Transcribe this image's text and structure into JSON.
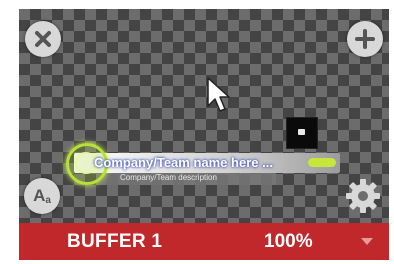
{
  "buffer": {
    "title": "BUFFER 1",
    "zoom": "100%"
  },
  "lower_third": {
    "name": "Company/Team name here ...",
    "description": "Company/Team description"
  },
  "icons": {
    "close": "close-icon",
    "add": "plus-icon",
    "text": "text-style-icon",
    "settings": "gear-icon",
    "dropdown": "chevron-down-icon",
    "cursor": "mouse-cursor-icon"
  },
  "text_button": {
    "big": "A",
    "small": "a"
  },
  "colors": {
    "footer": "#c0282b",
    "accent": "#c7e639"
  }
}
